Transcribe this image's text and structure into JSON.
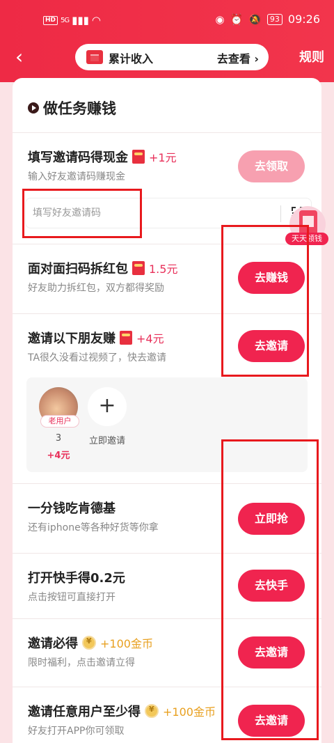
{
  "status_bar": {
    "hd": "HD",
    "signal": "5G",
    "battery": "93",
    "time": "09:26"
  },
  "header": {
    "back_icon": "chevron-left-icon",
    "pill_label": "累计收入",
    "pill_link": "去查看 ›",
    "rules_label": "规则"
  },
  "section_title": "做任务赚钱",
  "tasks": [
    {
      "title": "填写邀请码得现金",
      "reward": "+1元",
      "subtitle": "输入好友邀请码赚现金",
      "button": "去领取",
      "reward_icon": "red-packet-icon"
    },
    {
      "title": "面对面扫码拆红包",
      "reward": "1.5元",
      "subtitle": "好友助力拆红包，双方都得奖励",
      "button": "去赚钱",
      "reward_icon": "red-packet-icon"
    },
    {
      "title": "邀请以下朋友赚",
      "reward": "+4元",
      "subtitle": "TA很久没看过视频了，快去邀请",
      "button": "去邀请",
      "reward_icon": "red-packet-icon"
    },
    {
      "title": "一分钱吃肯德基",
      "subtitle": "还有iphone等各种好货等你拿",
      "button": "立即抢"
    },
    {
      "title": "打开快手得0.2元",
      "subtitle": "点击按钮可直接打开",
      "button": "去快手"
    },
    {
      "title": "邀请必得",
      "reward": "+100金币",
      "subtitle": "限时福利，点击邀请立得",
      "button": "去邀请",
      "reward_icon": "coin-icon"
    },
    {
      "title": "邀请任意用户至少得",
      "reward": "+100金币",
      "subtitle": "好友打开APP你可领取",
      "button": "去邀请",
      "reward_icon": "coin-icon"
    }
  ],
  "invite_input": {
    "placeholder": "填写好友邀请码"
  },
  "float_ad": {
    "label": "天天领钱"
  },
  "friends": {
    "friend": {
      "badge": "老用户",
      "count": "3",
      "reward": "+4元"
    },
    "add_symbol": "+",
    "add_label": "立即邀请"
  },
  "colors": {
    "accent": "#f0244f",
    "header_bg": "#ee2a45",
    "highlight": "#e8191d"
  }
}
